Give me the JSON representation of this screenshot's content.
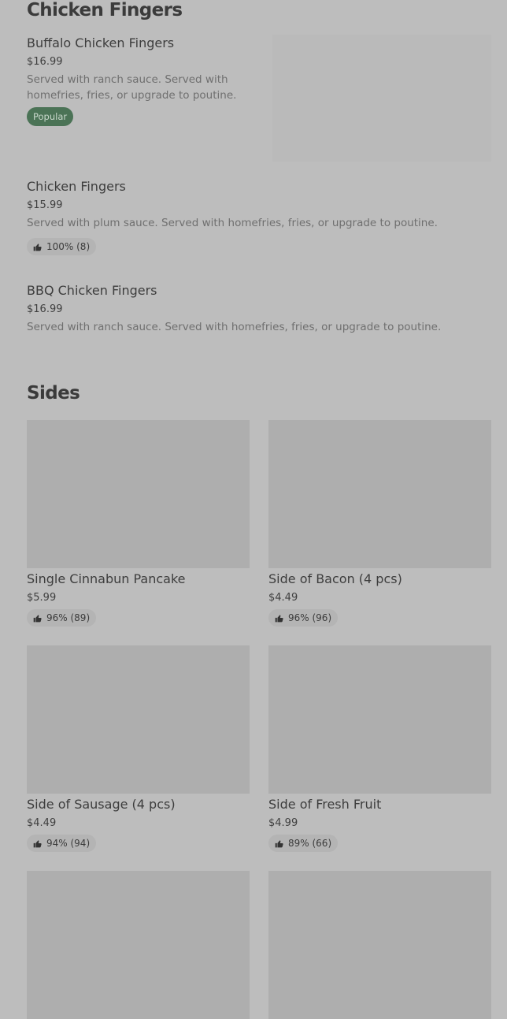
{
  "sections": [
    {
      "title": "Chicken Fingers",
      "items": [
        {
          "name": "Buffalo Chicken Fingers",
          "price": "$16.99",
          "description": "Served with ranch sauce. Served with homefries, fries, or upgrade to poutine.",
          "badge": "Popular"
        },
        {
          "name": "Chicken Fingers",
          "price": "$15.99",
          "description": "Served with plum sauce. Served with homefries, fries, or upgrade to poutine.",
          "rating": "100% (8)"
        },
        {
          "name": "BBQ Chicken Fingers",
          "price": "$16.99",
          "description": "Served with ranch sauce. Served with homefries, fries, or upgrade to poutine."
        }
      ]
    },
    {
      "title": "Sides",
      "items": [
        {
          "name": "Single Cinnabun Pancake",
          "price": "$5.99",
          "rating": "96% (89)"
        },
        {
          "name": "Side of Bacon (4 pcs)",
          "price": "$4.49",
          "rating": "96% (96)"
        },
        {
          "name": "Side of Sausage (4 pcs)",
          "price": "$4.49",
          "rating": "94% (94)"
        },
        {
          "name": "Side of Fresh Fruit",
          "price": "$4.99",
          "rating": "89% (66)"
        }
      ]
    }
  ],
  "icons": {
    "rating": "thumbs-up-icon"
  },
  "colors": {
    "popular_badge": "#4b7356",
    "overlay_background": "#bdbdbd"
  }
}
